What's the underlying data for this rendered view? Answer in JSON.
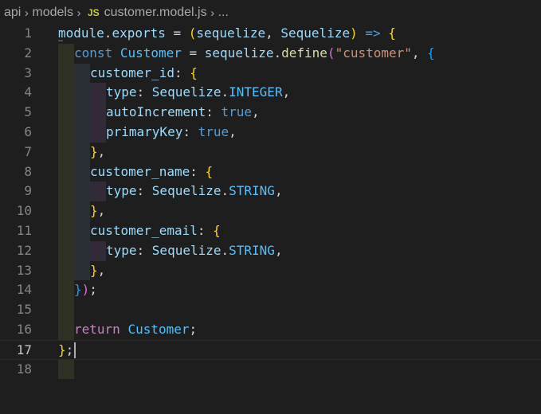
{
  "breadcrumb": {
    "items": [
      "api",
      "models",
      "customer.model.js",
      "..."
    ],
    "file_icon": "JS"
  },
  "editor": {
    "active_line": 17,
    "lines": [
      {
        "n": "1",
        "tokens": [
          [
            "var",
            "module"
          ],
          [
            "punc",
            "."
          ],
          [
            "var",
            "exports"
          ],
          [
            "punc",
            " = "
          ],
          [
            "b1",
            "("
          ],
          [
            "var",
            "sequelize"
          ],
          [
            "punc",
            ", "
          ],
          [
            "var",
            "Sequelize"
          ],
          [
            "b1",
            ")"
          ],
          [
            "punc",
            " "
          ],
          [
            "kw",
            "=>"
          ],
          [
            "punc",
            " "
          ],
          [
            "b1",
            "{"
          ]
        ]
      },
      {
        "n": "2",
        "tokens": [
          [
            "kw",
            "const"
          ],
          [
            "punc",
            " "
          ],
          [
            "const",
            "Customer"
          ],
          [
            "punc",
            " = "
          ],
          [
            "var",
            "sequelize"
          ],
          [
            "punc",
            "."
          ],
          [
            "fn",
            "define"
          ],
          [
            "b2",
            "("
          ],
          [
            "str",
            "\"customer\""
          ],
          [
            "punc",
            ", "
          ],
          [
            "b3",
            "{"
          ]
        ]
      },
      {
        "n": "3",
        "tokens": [
          [
            "var",
            "customer_id"
          ],
          [
            "punc",
            ": "
          ],
          [
            "b1",
            "{"
          ]
        ]
      },
      {
        "n": "4",
        "tokens": [
          [
            "var",
            "type"
          ],
          [
            "punc",
            ": "
          ],
          [
            "var",
            "Sequelize"
          ],
          [
            "punc",
            "."
          ],
          [
            "const",
            "INTEGER"
          ],
          [
            "punc",
            ","
          ]
        ]
      },
      {
        "n": "5",
        "tokens": [
          [
            "var",
            "autoIncrement"
          ],
          [
            "punc",
            ": "
          ],
          [
            "kw",
            "true"
          ],
          [
            "punc",
            ","
          ]
        ]
      },
      {
        "n": "6",
        "tokens": [
          [
            "var",
            "primaryKey"
          ],
          [
            "punc",
            ": "
          ],
          [
            "kw",
            "true"
          ],
          [
            "punc",
            ","
          ]
        ]
      },
      {
        "n": "7",
        "tokens": [
          [
            "b1",
            "}"
          ],
          [
            "punc",
            ","
          ]
        ]
      },
      {
        "n": "8",
        "tokens": [
          [
            "var",
            "customer_name"
          ],
          [
            "punc",
            ": "
          ],
          [
            "b1",
            "{"
          ]
        ]
      },
      {
        "n": "9",
        "tokens": [
          [
            "var",
            "type"
          ],
          [
            "punc",
            ": "
          ],
          [
            "var",
            "Sequelize"
          ],
          [
            "punc",
            "."
          ],
          [
            "const",
            "STRING"
          ],
          [
            "punc",
            ","
          ]
        ]
      },
      {
        "n": "10",
        "tokens": [
          [
            "b1",
            "}"
          ],
          [
            "punc",
            ","
          ]
        ]
      },
      {
        "n": "11",
        "tokens": [
          [
            "var",
            "customer_email"
          ],
          [
            "punc",
            ": "
          ],
          [
            "b1",
            "{"
          ]
        ]
      },
      {
        "n": "12",
        "tokens": [
          [
            "var",
            "type"
          ],
          [
            "punc",
            ": "
          ],
          [
            "var",
            "Sequelize"
          ],
          [
            "punc",
            "."
          ],
          [
            "const",
            "STRING"
          ],
          [
            "punc",
            ","
          ]
        ]
      },
      {
        "n": "13",
        "tokens": [
          [
            "b1",
            "}"
          ],
          [
            "punc",
            ","
          ]
        ]
      },
      {
        "n": "14",
        "tokens": [
          [
            "b3",
            "}"
          ],
          [
            "b2",
            ")"
          ],
          [
            "punc",
            ";"
          ]
        ]
      },
      {
        "n": "15",
        "tokens": []
      },
      {
        "n": "16",
        "tokens": [
          [
            "ctl",
            "return"
          ],
          [
            "punc",
            " "
          ],
          [
            "const",
            "Customer"
          ],
          [
            "punc",
            ";"
          ]
        ]
      },
      {
        "n": "17",
        "tokens": [
          [
            "b1",
            "}"
          ],
          [
            "punc",
            ";"
          ]
        ]
      },
      {
        "n": "18",
        "tokens": []
      }
    ]
  }
}
